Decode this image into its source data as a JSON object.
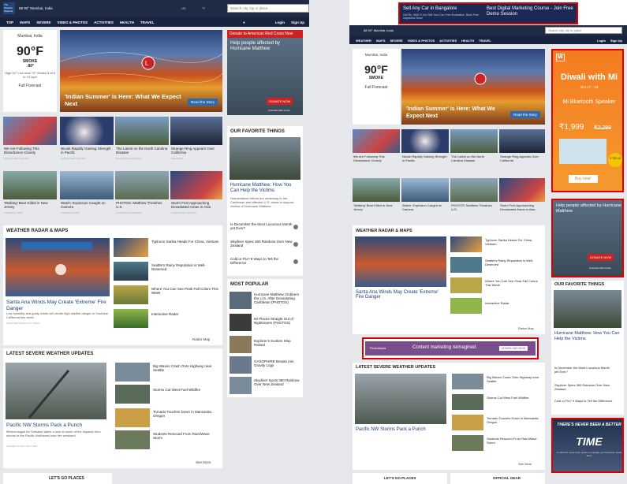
{
  "left": {
    "logo": "The Weather Channel",
    "location": "88 90° Mumbai, India",
    "unit": "US",
    "temp_unit": "°F",
    "search_placeholder": "Search city, zip or place",
    "login": "Login",
    "signup": "Sign Up",
    "nav": [
      "TOP",
      "MAPS",
      "SEVERE",
      "VIDEO & PHOTOS",
      "ACTIVITIES",
      "HEALTH",
      "TRAVEL"
    ],
    "forecast": {
      "city": "Mumbai, India",
      "temp": "90°F",
      "cond": "SMOKE",
      "feels": "↓80°",
      "detail": "High 92°  Low near 79° Winds N at 5 to 10 mph",
      "link": "Full Forecast"
    },
    "hero": {
      "title": "'Indian Summer' is Here: What We Expect Next",
      "button": "Read the Story"
    },
    "ad": {
      "header": "Donate to American Red Cross Now",
      "title": "Help people affected by Hurricane Matthew",
      "donate": "DONATE NOW",
      "org": "American Red Cross"
    },
    "thumbs1": [
      {
        "cap": "We Are Following This Disturbance Closely",
        "sub": "HURRICANE CENTRAL"
      },
      {
        "cap": "Nicole Rapidly Gaining Strength in Pacific",
        "sub": "HURRICANE CENTRAL"
      },
      {
        "cap": "The Latest on the North Carolina Disaster",
        "sub": "HURRICANE CENTRAL"
      },
      {
        "cap": "Strange Ring Appears Over California",
        "sub": "WEATHER"
      }
    ],
    "thumbs2": [
      {
        "cap": "'Walking' Bear Killed in New Jersey",
        "sub": "TRENDING NOW"
      },
      {
        "cap": "Watch: Explosion Caught on Camera",
        "sub": "TRENDING NOW"
      },
      {
        "cap": "PHOTOS: Matthew Thrashes U.S.",
        "sub": "HURRICANE CENTRAL"
      },
      {
        "cap": "Storm Fest Approaching Devastated Areas in Asia",
        "sub": "HURRICANE CENTRAL"
      }
    ],
    "favorite": {
      "heading": "OUR FAVORITE THINGS",
      "title": "Hurricane Matthew: How You Can Help the Victims",
      "desc": "Humanitarian efforts are underway in the Caribbean and affected U.S. areas to support victims of Hurricane Matthew",
      "items": [
        "Is December the Most Luxurious Month yet Ever?",
        "Skydiver Spies 360 Rainbow Over New Zealand",
        "Cold or Flu? 9 Ways to Tell the Difference"
      ]
    },
    "radar": {
      "heading": "WEATHER RADAR & MAPS",
      "title": "Santa Ana Winds May Create 'Extreme' Fire Danger",
      "desc": "Low humidity and gusty winds will create high wildfire danger in Southern California this week.",
      "sub": "WEATHER  FORECAST VIDEO",
      "side": [
        {
          "cap": "Typhoon Sarika Heads For China, Vietnam",
          "sub": "WEATHER"
        },
        {
          "cap": "Seattle's Rainy Reputation is Well-Deserved",
          "sub": "NEWS"
        },
        {
          "cap": "Where You Can See Peak Fall Colors This Week",
          "sub": "WEATHER"
        },
        {
          "cap": "Interactive Radar",
          "sub": ""
        }
      ],
      "more": "Radar Map"
    },
    "most": {
      "heading": "MOST POPULAR",
      "items": [
        "Hurricane Matthew Clobbers the U.S. After Devastating Caribbean (PHOTOS)",
        "50 Places Straight Out of Nightmares (PHOTOS)",
        "Explorer's Sunken Ship Raised",
        "GASOPHIRE Breaks into Gravity Logs",
        "Skydiver Spots 360 Rainbow Over New Zealand"
      ]
    },
    "severe": {
      "heading": "LATEST SEVERE WEATHER UPDATES",
      "title": "Pacific NW Storms Pack a Punch",
      "desc": "Meteorologist Ari Sarsalari takes a look at some of the impacts from storms in the Pacific Northwest over the weekend.",
      "sub": "SEVERE STORM TRACKER",
      "side": [
        {
          "cap": "Big Waves Crash Onto Highway near Seattle",
          "sub": "SEVERE STORM TRACKER"
        },
        {
          "cap": "Storms Cut West Fuel Wildfire",
          "sub": "SEVERE STORM TRACKER"
        },
        {
          "cap": "Tornado Touches Down in Manzanita, Oregon",
          "sub": "SEVERE STORM TRACKER"
        },
        {
          "cap": "Students Rescued From Rain/Wave Storm",
          "sub": "SEVERE STORM TRACKER"
        }
      ],
      "more": "See More"
    },
    "places": "LET'S GO PLACES"
  },
  "right": {
    "topad": {
      "left_title": "Sell Any Car in Bangalore",
      "left_desc": "Get Rs. 5000 If You Sell Your Car. Free Evaluation. Book Free Inspection Now!",
      "right_title": "Best Digital Marketing Course - Join Free Demo Session"
    },
    "location": "88 90° Mumbai, India",
    "search_placeholder": "Search city, zip or place",
    "login": "Login",
    "signup": "Sign Up",
    "nav": [
      "WEATHER",
      "MAPS",
      "SEVERE",
      "VIDEO & PHOTOS",
      "ACTIVITIES",
      "HEALTH",
      "TRAVEL"
    ],
    "diwali": {
      "brand": "MI",
      "title": "Diwali with Mi",
      "dates": "Oct 17 - 19",
      "product": "Mi Bluetooth Speaker",
      "price": "₹1,999",
      "old_price": "₹2,299",
      "badge": "₹ 700 off",
      "cta": "Buy now!"
    },
    "ad2": {
      "title": "Help people affected by Hurricane Matthew",
      "donate": "DONATE NOW",
      "org": "American Red Cross"
    },
    "midad": {
      "brand": "Pennatopia",
      "text": "Content marketing reimagined.",
      "cta": "DOWNLOAD NOW"
    },
    "timead": {
      "line1": "THERE'S NEVER BEEN A BETTER",
      "line2": "TIME",
      "line3": "In 2016 it's never been easier to manage your business. Read More"
    },
    "favorite_heading": "OUR FAVORITE THINGS",
    "favorite_title": "Hurricane Matthew: How You Can Help the Victims",
    "favorite_items": [
      "Is December the Most Luxurious Month yet Ever?",
      "Skydiver Spies 360 Rainbow Over New Zealand",
      "Cold or Flu? 9 Ways to Tell the Difference"
    ],
    "radar_heading": "WEATHER RADAR & MAPS",
    "radar_more": "Radar Map",
    "severe_heading": "LATEST SEVERE WEATHER UPDATES",
    "severe_title": "Pacific NW Storms Pack a Punch",
    "more": "See More",
    "places": "LET'S GO PLACES",
    "gear": "OFFICIAL GEAR"
  },
  "colors": {
    "nav": "#18243f",
    "accent": "#2c6bb1",
    "ad_red": "#c22",
    "highlight": "#d00"
  }
}
